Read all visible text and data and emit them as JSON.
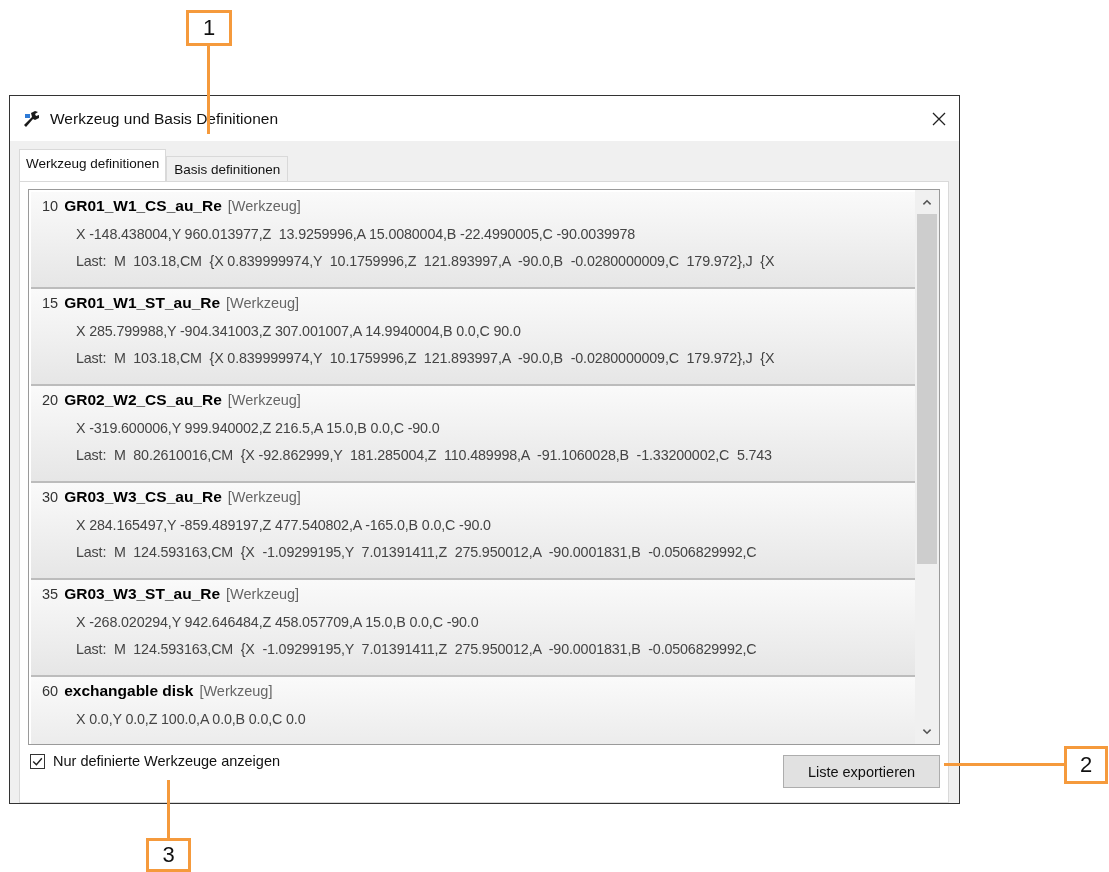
{
  "window": {
    "title": "Werkzeug und Basis Definitionen"
  },
  "tabs": [
    {
      "label": "Werkzeug definitionen",
      "selected": true
    },
    {
      "label": "Basis definitionen",
      "selected": false
    }
  ],
  "items": [
    {
      "number": "10",
      "name": "GR01_W1_CS_au_Re",
      "tag": "[Werkzeug]",
      "coordinates": "X -148.438004,Y 960.013977,Z  13.9259996,A 15.0080004,B -22.4990005,C -90.0039978",
      "last": "Last:  M  103.18,CM  {X 0.839999974,Y  10.1759996,Z  121.893997,A  -90.0,B  -0.0280000009,C  179.972},J  {X"
    },
    {
      "number": "15",
      "name": "GR01_W1_ST_au_Re",
      "tag": "[Werkzeug]",
      "coordinates": "X 285.799988,Y -904.341003,Z 307.001007,A 14.9940004,B 0.0,C 90.0",
      "last": "Last:  M  103.18,CM  {X 0.839999974,Y  10.1759996,Z  121.893997,A  -90.0,B  -0.0280000009,C  179.972},J  {X"
    },
    {
      "number": "20",
      "name": "GR02_W2_CS_au_Re",
      "tag": "[Werkzeug]",
      "coordinates": "X -319.600006,Y 999.940002,Z 216.5,A 15.0,B 0.0,C -90.0",
      "last": "Last:  M  80.2610016,CM  {X -92.862999,Y  181.285004,Z  110.489998,A  -91.1060028,B  -1.33200002,C  5.743"
    },
    {
      "number": "30",
      "name": "GR03_W3_CS_au_Re",
      "tag": "[Werkzeug]",
      "coordinates": "X 284.165497,Y -859.489197,Z 477.540802,A -165.0,B 0.0,C -90.0",
      "last": "Last:  M  124.593163,CM  {X  -1.09299195,Y  7.01391411,Z  275.950012,A  -90.0001831,B  -0.0506829992,C"
    },
    {
      "number": "35",
      "name": "GR03_W3_ST_au_Re",
      "tag": "[Werkzeug]",
      "coordinates": "X -268.020294,Y 942.646484,Z 458.057709,A 15.0,B 0.0,C -90.0",
      "last": "Last:  M  124.593163,CM  {X  -1.09299195,Y  7.01391411,Z  275.950012,A  -90.0001831,B  -0.0506829992,C"
    },
    {
      "number": "60",
      "name": "exchangable disk",
      "tag": "[Werkzeug]",
      "coordinates": "X 0.0,Y 0.0,Z 100.0,A 0.0,B 0.0,C 0.0"
    }
  ],
  "filter": {
    "label": "Nur definierte Werkzeuge anzeigen",
    "checked": true
  },
  "export_button": "Liste exportieren",
  "callouts": [
    "1",
    "2",
    "3"
  ]
}
